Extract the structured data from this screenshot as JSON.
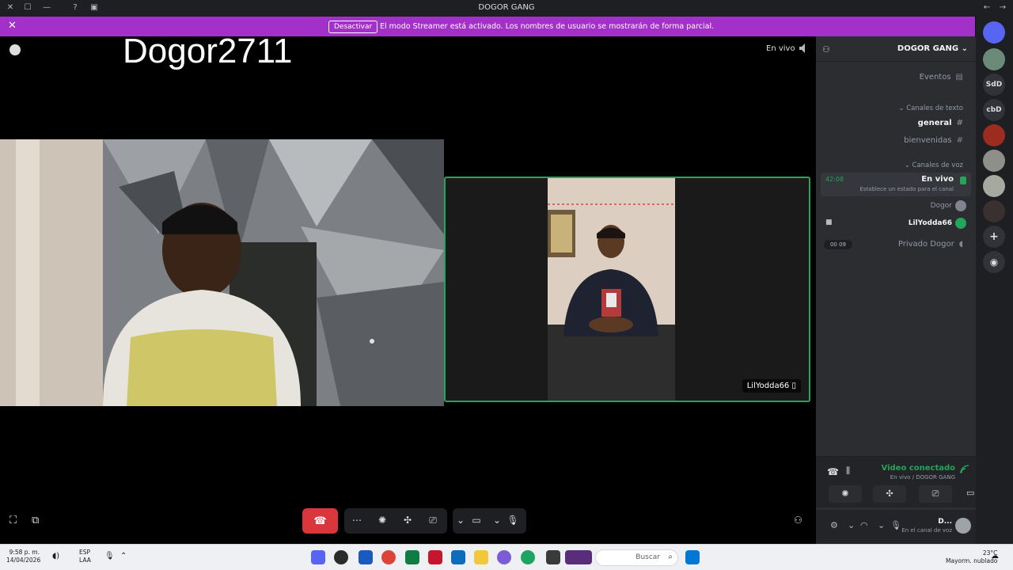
{
  "window": {
    "title": "DOGOR GANG"
  },
  "banner": {
    "message": "El modo Streamer está activado. Los nombres de usuario se mostrarán de forma parcial.",
    "button_label": "Desactivar"
  },
  "stage": {
    "overlay_name": "Dogor2711",
    "live_label": "En vivo",
    "remote_name": "LilYodda66"
  },
  "sidebar": {
    "server_name": "DOGOR GANG",
    "events_label": "Eventos",
    "text_category": "Canales de texto",
    "text_channels": [
      "general",
      "bienvenidas"
    ],
    "voice_category": "Canales de voz",
    "live_channel": {
      "name": "En vivo",
      "timer": "42:08",
      "status_hint": "Establece un estado para el canal"
    },
    "voice_users": [
      "Dogor",
      "LilYodda66"
    ],
    "private_channel": "Privado Dogor",
    "private_pill": "00 09"
  },
  "voice_panel": {
    "status": "Video conectado",
    "sub": "En vivo / DOGOR GANG"
  },
  "user_panel": {
    "name": "D...",
    "status": "En el canal de voz"
  },
  "rail": {
    "text_servers": [
      "SdD",
      "cbD"
    ]
  },
  "taskbar": {
    "time": "9:58 p. m.",
    "date": "14/04/2026",
    "lang_line1": "ESP",
    "lang_line2": "LAA",
    "search_placeholder": "Buscar",
    "weather_temp": "23°C",
    "weather_desc": "Mayorm. nublado"
  },
  "colors": {
    "banner": "#a330c9",
    "accent_green": "#23a55a",
    "hangup_red": "#da373c",
    "sidebar_bg": "#2b2d31",
    "rail_bg": "#1e1f22"
  }
}
